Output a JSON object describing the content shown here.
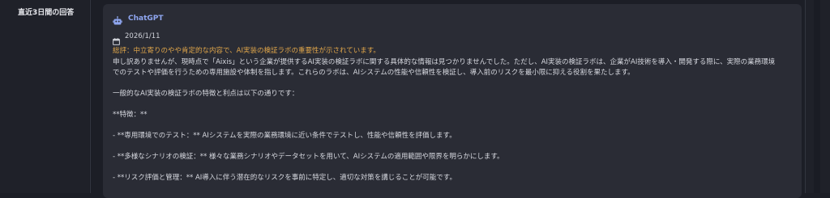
{
  "sidebar": {
    "label": "直近3日間の回答"
  },
  "card": {
    "source_name": "ChatGPT",
    "date": "2026/1/11",
    "evaluation": "総評：中立寄りのやや肯定的な内容で、AI実装の検証ラボの重要性が示されています。",
    "body": {
      "line1": "申し訳ありませんが、現時点で「Aixis」という企業が提供するAI実装の検証ラボに関する具体的な情報は見つかりませんでした。ただし、AI実装の検証ラボは、企業がAI技術を導入・開発する際に、実際の業務環境",
      "line2": "でのテストや評価を行うための専用施設や体制を指します。これらのラボは、AIシステムの性能や信頼性を検証し、導入前のリスクを最小限に抑える役割を果たします。",
      "line3": "一般的なAI実装の検証ラボの特徴と利点は以下の通りです：",
      "line4": "**特徴：**",
      "line5": "- **専用環境でのテスト：** AIシステムを実際の業務環境に近い条件でテストし、性能や信頼性を評価します。",
      "line6": "- **多様なシナリオの検証：** 様々な業務シナリオやデータセットを用いて、AIシステムの適用範囲や限界を明らかにします。",
      "line7": "- **リスク評価と管理：** AI導入に伴う潜在的なリスクを事前に特定し、適切な対策を講じることが可能です。"
    }
  },
  "colors": {
    "background": "#1c1e26",
    "card": "#2a2c35",
    "accent": "#8fa6f0",
    "evaluation": "#e0a64a"
  },
  "icons": {
    "bot": "robot-icon",
    "date": "calendar-icon"
  }
}
